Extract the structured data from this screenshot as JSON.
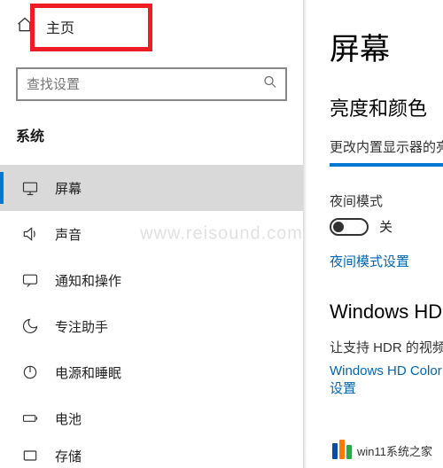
{
  "header": {
    "home_label": "主页"
  },
  "search": {
    "placeholder": "查找设置"
  },
  "section_title": "系统",
  "nav": {
    "items": [
      {
        "label": "屏幕"
      },
      {
        "label": "声音"
      },
      {
        "label": "通知和操作"
      },
      {
        "label": "专注助手"
      },
      {
        "label": "电源和睡眠"
      },
      {
        "label": "电池"
      },
      {
        "label": "存储"
      }
    ]
  },
  "content": {
    "title": "屏幕",
    "brightness_heading": "亮度和颜色",
    "brightness_desc": "更改内置显示器的亮度",
    "night_mode_label": "夜间模式",
    "toggle_state": "关",
    "night_mode_settings": "夜间模式设置",
    "hd_title": "Windows HD Color",
    "hd_desc": "让支持 HDR 的视频、游戏和应用画面更明亮、更生动。",
    "hd_link": "Windows HD Color 设置"
  },
  "watermark": "www.reisound.com",
  "footer": "win11系统之家"
}
